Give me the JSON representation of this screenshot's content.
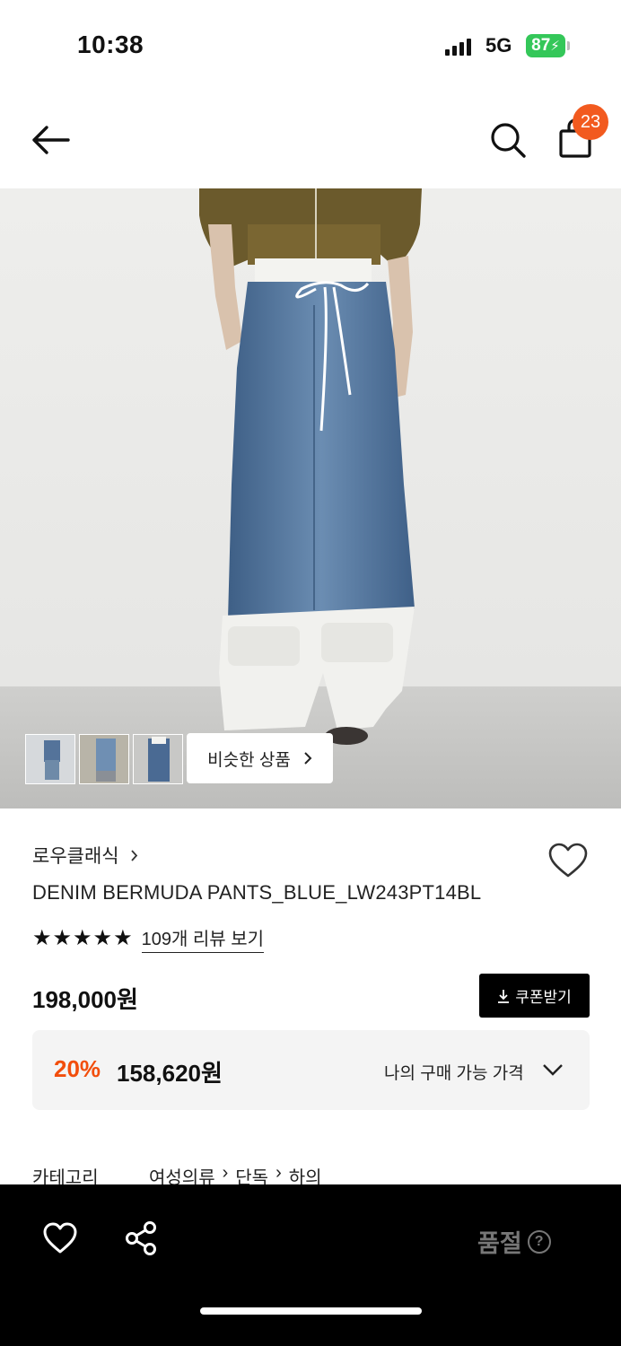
{
  "status_bar": {
    "time": "10:38",
    "network": "5G",
    "battery": "87"
  },
  "header": {
    "cart_count": "23"
  },
  "gallery": {
    "similar_label": "비슷한 상품"
  },
  "product": {
    "brand": "로우클래식",
    "name": "DENIM BERMUDA PANTS_BLUE_LW243PT14BL",
    "rating_stars": 5,
    "review_link": "109개 리뷰 보기",
    "price": "198,000원",
    "coupon_label": "쿠폰받기",
    "discount_rate": "20%",
    "sale_price": "158,620원",
    "my_price_label": "나의 구매 가능 가격"
  },
  "category": {
    "label": "카테고리",
    "path": [
      "여성의류",
      "단독",
      "하의"
    ]
  },
  "bottom_bar": {
    "status_label": "품절",
    "help_symbol": "?"
  },
  "icons": [
    "back-arrow-icon",
    "search-icon",
    "shopping-bag-icon",
    "heart-icon",
    "share-icon",
    "chevron-right-icon",
    "chevron-down-icon",
    "download-icon",
    "star-icon",
    "help-icon"
  ],
  "colors": {
    "accent": "#f24e0c",
    "badge": "#f25a1f",
    "battery": "#34c759",
    "bar": "#000000"
  }
}
